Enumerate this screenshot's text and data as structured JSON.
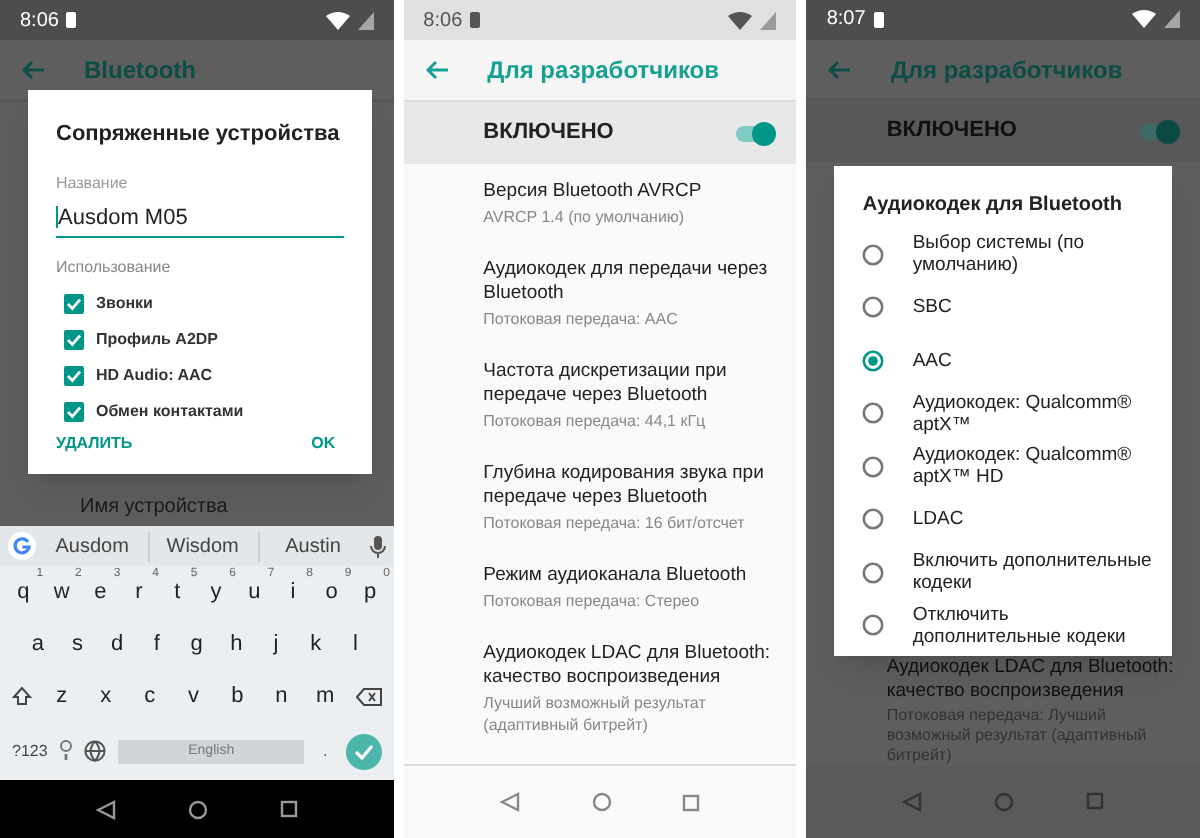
{
  "pairing_screen": {
    "status_time": "8:06",
    "app_bar_title": "Bluetooth",
    "background_item": "Имя устройства",
    "dialog": {
      "title": "Сопряженные устройства",
      "name_label": "Название",
      "name_value": "Ausdom M05",
      "usage_label": "Использование",
      "options": [
        {
          "label": "Звонки",
          "checked": true
        },
        {
          "label": "Профиль A2DP",
          "checked": true
        },
        {
          "label": "HD Audio: AAC",
          "checked": true
        },
        {
          "label": "Обмен контактами",
          "checked": true
        }
      ],
      "buttons": [
        "УДАЛИТЬ",
        "OK"
      ]
    },
    "keyboard": {
      "suggestions": [
        "Ausdom",
        "Wisdom",
        "Austin"
      ],
      "rows": [
        {
          "keys": [
            {
              "label": "q",
              "hint": "1"
            },
            {
              "label": "w",
              "hint": "2"
            },
            {
              "label": "e",
              "hint": "3"
            },
            {
              "label": "r",
              "hint": "4"
            },
            {
              "label": "t",
              "hint": "5"
            },
            {
              "label": "y",
              "hint": "6"
            },
            {
              "label": "u",
              "hint": "7"
            },
            {
              "label": "i",
              "hint": "8"
            },
            {
              "label": "o",
              "hint": "9"
            },
            {
              "label": "p",
              "hint": "0"
            }
          ]
        },
        {
          "keys": [
            {
              "label": "a"
            },
            {
              "label": "s"
            },
            {
              "label": "d"
            },
            {
              "label": "f"
            },
            {
              "label": "g"
            },
            {
              "label": "h"
            },
            {
              "label": "j"
            },
            {
              "label": "k"
            },
            {
              "label": "l"
            }
          ]
        },
        {
          "keys": [
            {
              "label": "z"
            },
            {
              "label": "x"
            },
            {
              "label": "c"
            },
            {
              "label": "v"
            },
            {
              "label": "b"
            },
            {
              "label": "n"
            },
            {
              "label": "m"
            }
          ]
        }
      ],
      "symbols_key": "?123",
      "space_label": "English",
      "period_key": "."
    }
  },
  "developer_screen": {
    "status_time": "8:06",
    "app_bar_title": "Для разработчиков",
    "master_switch": {
      "label": "ВКЛЮЧЕНО",
      "on": true
    },
    "items": [
      {
        "title": "Версия Bluetooth AVRCP",
        "summary": "AVRCP 1.4 (по умолчанию)"
      },
      {
        "title": "Аудиокодек для передачи через Bluetooth",
        "summary": "Потоковая передача: AAC"
      },
      {
        "title": "Частота дискретизации при передаче через Bluetooth",
        "summary": "Потоковая передача: 44,1 кГц"
      },
      {
        "title": "Глубина кодирования звука при передаче через Bluetooth",
        "summary": "Потоковая передача: 16 бит/отсчет"
      },
      {
        "title": "Режим аудиоканала Bluetooth",
        "summary": "Потоковая передача: Стерео"
      },
      {
        "title": "Аудиокодек LDAC для Bluetooth: качество воспроизведения",
        "summary": "Лучший возможный результат (адаптивный битрейт)"
      }
    ]
  },
  "codec_screen": {
    "status_time": "8:07",
    "app_bar_title": "Для разработчиков",
    "master_switch": {
      "label": "ВКЛЮЧЕНО",
      "on": true
    },
    "dialog": {
      "title": "Аудиокодек для Bluetooth",
      "options": [
        {
          "label": "Выбор системы (по умолчанию)",
          "selected": false
        },
        {
          "label": "SBC",
          "selected": false
        },
        {
          "label": "AAC",
          "selected": true
        },
        {
          "label": "Аудиокодек: Qualcomm® aptX™",
          "selected": false
        },
        {
          "label": "Аудиокодек: Qualcomm® aptX™ HD",
          "selected": false
        },
        {
          "label": "LDAC",
          "selected": false
        },
        {
          "label": "Включить дополнительные кодеки",
          "selected": false
        },
        {
          "label": "Отключить дополнительные кодеки",
          "selected": false
        }
      ]
    },
    "background_item": {
      "title": "Аудиокодек LDAC для Bluetooth: качество воспроизведения",
      "summary": "Потоковая передача: Лучший возможный результат (адаптивный битрейт)"
    }
  }
}
